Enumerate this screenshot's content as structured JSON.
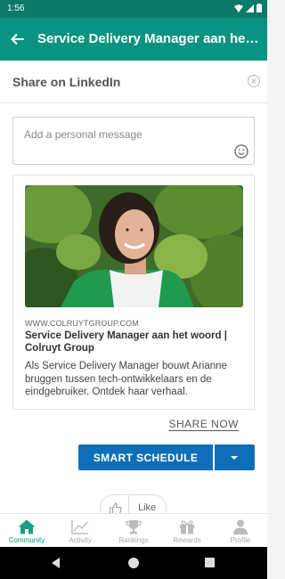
{
  "status_bar": {
    "time": "1:56"
  },
  "app_bar": {
    "title": "Service Delivery Manager aan het woord | Colruyt Group"
  },
  "share_sheet": {
    "title": "Share on LinkedIn",
    "message_placeholder": "Add a personal message",
    "card": {
      "domain": "WWW.COLRUYTGROUP.COM",
      "title": "Service Delivery Manager aan het woord | Colruyt Group",
      "description": "Als Service Delivery Manager bouwt Arianne bruggen tussen tech-ontwikkelaars en de eindgebruiker. Ontdek haar verhaal."
    },
    "share_now_label": "SHARE NOW",
    "smart_schedule_label": "SMART SCHEDULE"
  },
  "like": {
    "label": "Like"
  },
  "bottom_nav": {
    "items": [
      {
        "label": "Community",
        "icon": "home-icon",
        "active": true
      },
      {
        "label": "Activity",
        "icon": "chart-icon",
        "active": false
      },
      {
        "label": "Rankings",
        "icon": "trophy-icon",
        "active": false
      },
      {
        "label": "Rewards",
        "icon": "gift-icon",
        "active": false
      },
      {
        "label": "Profile",
        "icon": "person-icon",
        "active": false
      }
    ]
  },
  "colors": {
    "primary": "#0b9381",
    "status_bar": "#0b7a6b",
    "button_blue": "#0e6fb8"
  }
}
